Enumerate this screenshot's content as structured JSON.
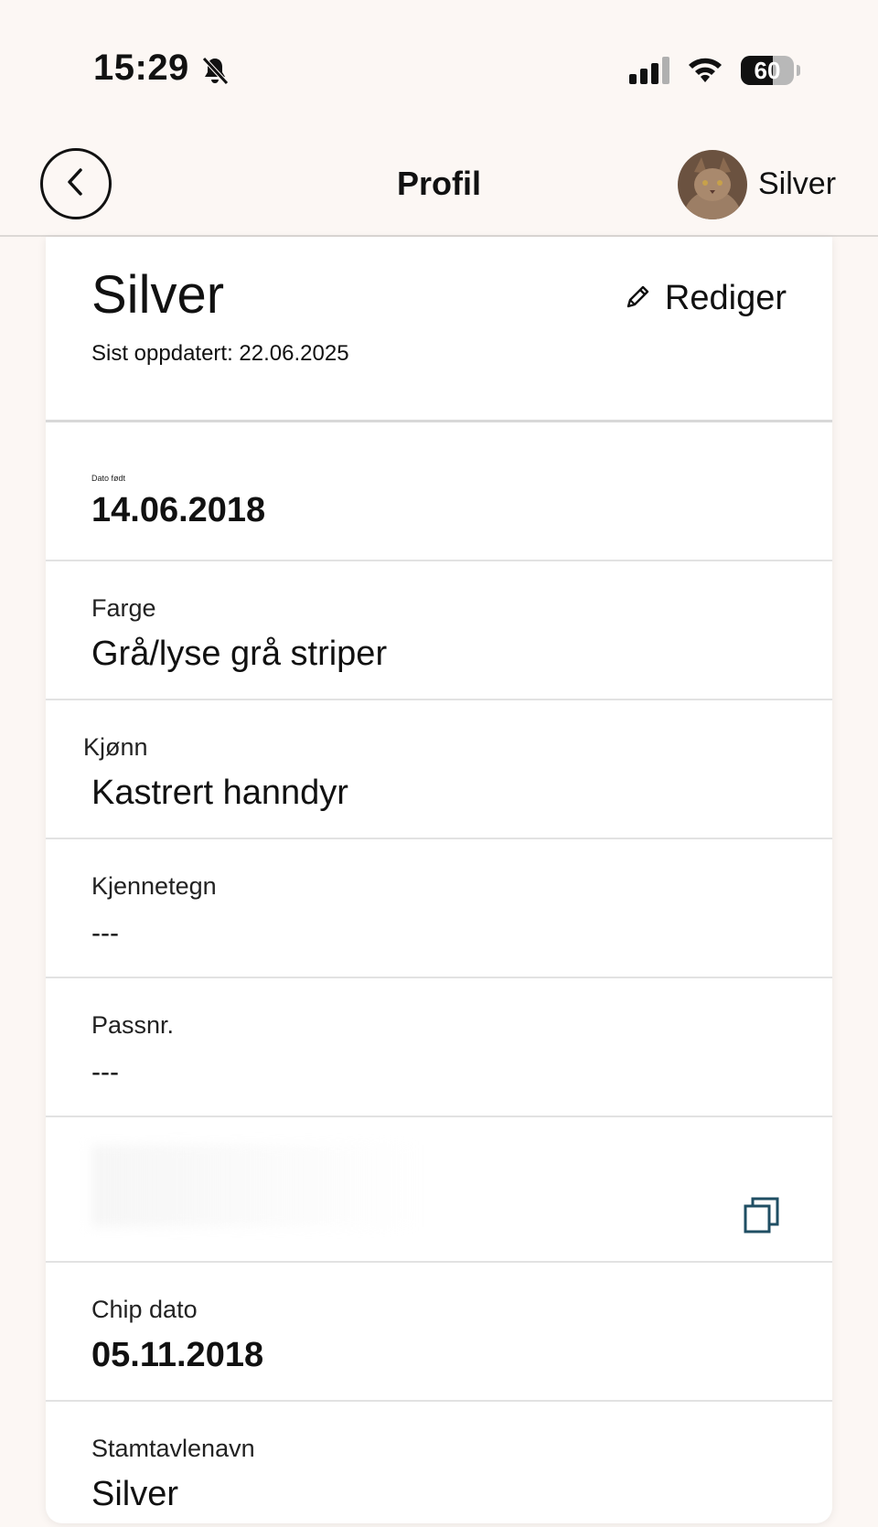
{
  "status_bar": {
    "time": "15:29",
    "battery_level": "60",
    "battery_fraction": 0.6,
    "icons": [
      "bell-slash-icon",
      "signal-icon",
      "wifi-icon",
      "battery-icon"
    ]
  },
  "nav": {
    "title": "Profil",
    "back_icon": "chevron-left-icon",
    "user_name": "Silver"
  },
  "profile": {
    "name": "Silver",
    "updated": "Sist oppdatert: 22.06.2025",
    "edit_label": "Rediger",
    "edit_icon": "pencil-icon"
  },
  "fields": [
    {
      "label": "Dato født",
      "value": "14.06.2018"
    },
    {
      "label": "Farge",
      "value": "Grå/lyse grå striper"
    },
    {
      "label": "Kjønn",
      "value": "Kastrert hanndyr"
    },
    {
      "label": "Kjennetegn",
      "value": "---"
    },
    {
      "label": "Passnr.",
      "value": "---"
    },
    {
      "label": "",
      "value": "",
      "icon": "copy-icon"
    },
    {
      "label": "Chip dato",
      "value": "05.11.2018"
    },
    {
      "label": "Stamtavlenavn",
      "value": "Silver"
    }
  ],
  "colors": {
    "background": "#fcf7f4",
    "card": "#ffffff",
    "copy_icon": "#1f4e63"
  }
}
